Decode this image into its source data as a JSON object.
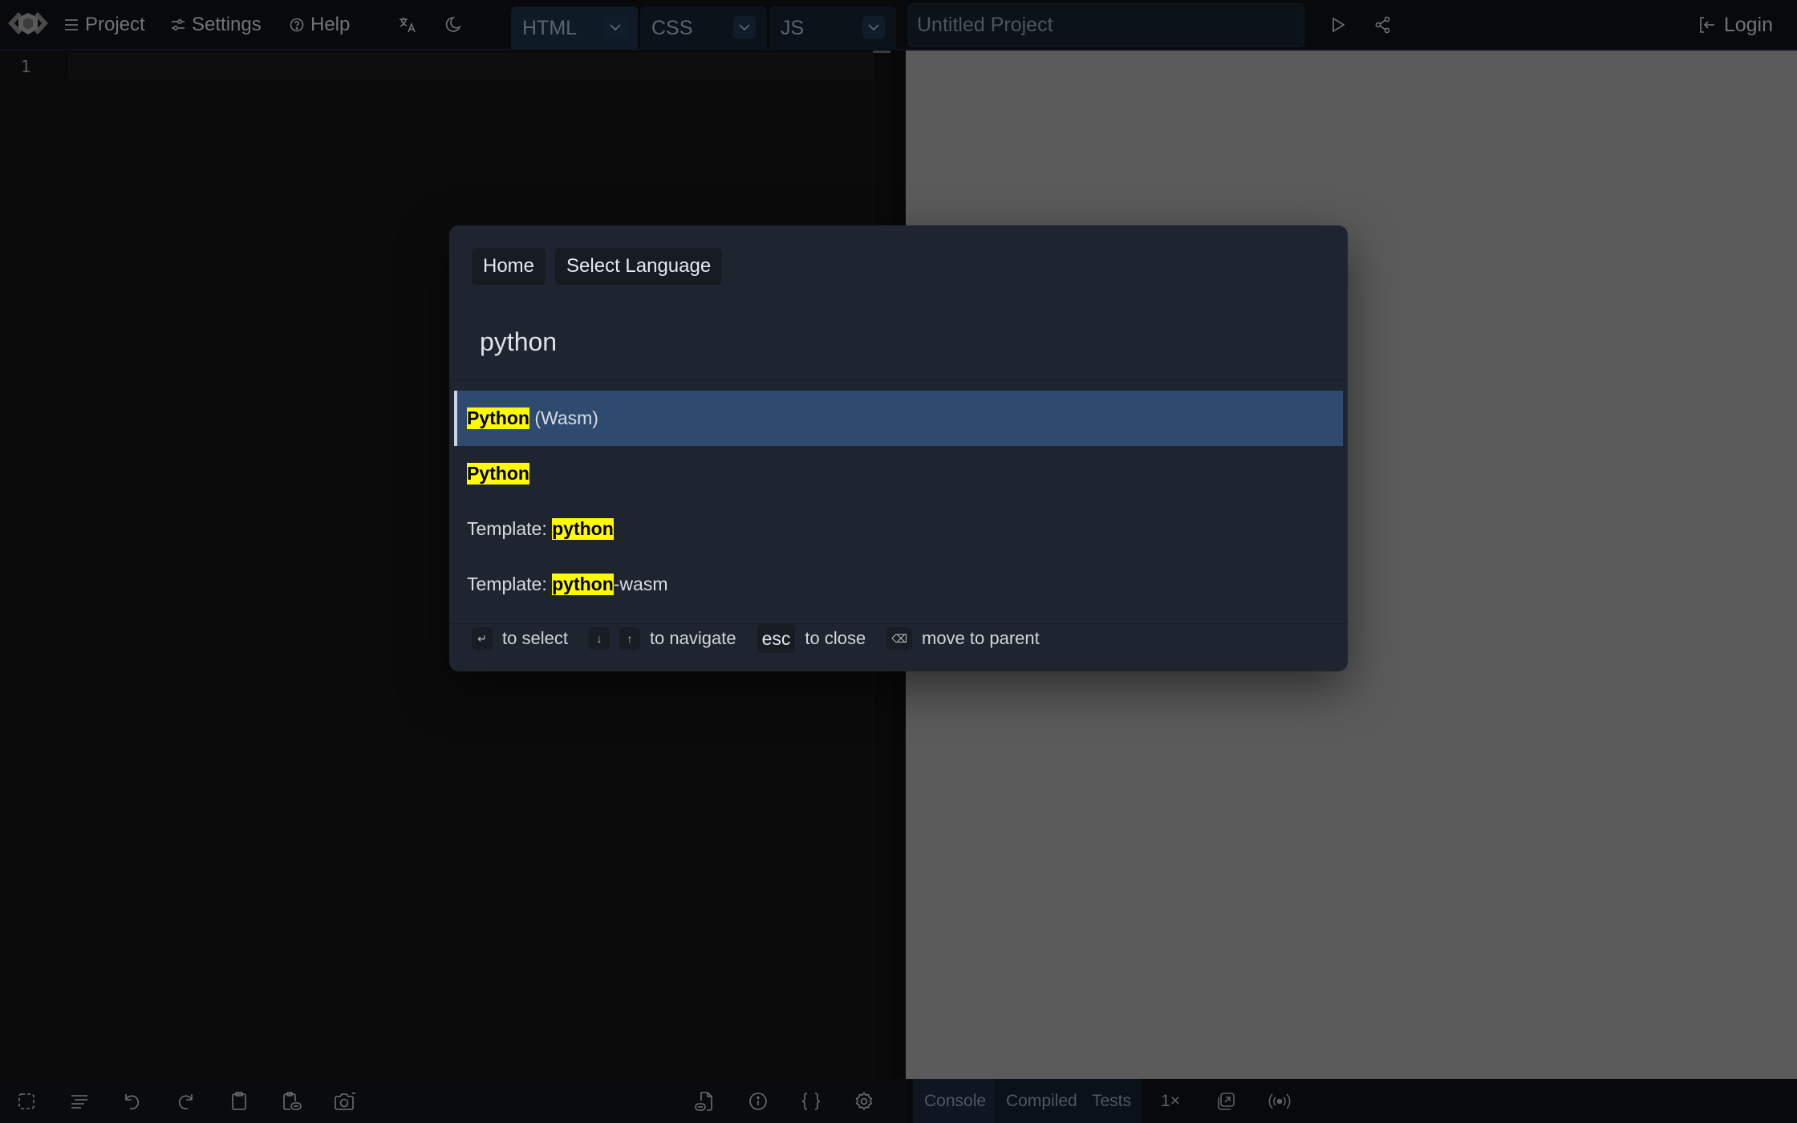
{
  "topbar": {
    "logo_icon": "livecodes-logo-icon",
    "menu": [
      {
        "label": "Project",
        "icon": "hamburger-icon"
      },
      {
        "label": "Settings",
        "icon": "sliders-icon"
      },
      {
        "label": "Help",
        "icon": "help-circle-icon"
      }
    ],
    "language_icon": "translate-icon",
    "theme_icon": "moon-icon",
    "editor_tabs": [
      {
        "label": "HTML",
        "active": true
      },
      {
        "label": "CSS",
        "active": false
      },
      {
        "label": "JS",
        "active": false
      }
    ],
    "project_title_placeholder": "Untitled Project",
    "run_icon": "play-icon",
    "share_icon": "share-icon",
    "login_label": "Login"
  },
  "editor": {
    "line_numbers": [
      "1"
    ]
  },
  "modal": {
    "breadcrumbs": [
      "Home",
      "Select Language"
    ],
    "search_value": "python",
    "results": [
      {
        "highlight": "Python",
        "rest": " (Wasm)",
        "prefix": "",
        "selected": true
      },
      {
        "highlight": "Python",
        "rest": "",
        "prefix": "",
        "selected": false
      },
      {
        "highlight": "python",
        "rest": "",
        "prefix": "Template: ",
        "selected": false
      },
      {
        "highlight": "python",
        "rest": "-wasm",
        "prefix": "Template: ",
        "selected": false
      }
    ],
    "footer": {
      "select_key": "↵",
      "select_label": "to select",
      "down_key": "↓",
      "up_key": "↑",
      "navigate_label": "to navigate",
      "esc_key": "esc",
      "close_label": "to close",
      "backspace_key": "⌫",
      "parent_label": "move to parent"
    },
    "highlight_color": "#fffb00",
    "selected_color": "#2e4a6f"
  },
  "editor_toolbar": {
    "icons": [
      "focus-icon",
      "format-icon",
      "undo-icon",
      "redo-icon",
      "copy-icon",
      "copy-as-url-icon",
      "screenshot-icon",
      "external-resources-icon",
      "info-icon",
      "code-braces-icon",
      "editor-settings-icon"
    ]
  },
  "result_toolbar": {
    "tabs": [
      {
        "label": "Console",
        "active": true
      },
      {
        "label": "Compiled",
        "active": false
      },
      {
        "label": "Tests",
        "active": false
      }
    ],
    "zoom_label": "1×",
    "open_new_window_icon": "external-window-icon",
    "broadcast_icon": "broadcast-icon"
  }
}
